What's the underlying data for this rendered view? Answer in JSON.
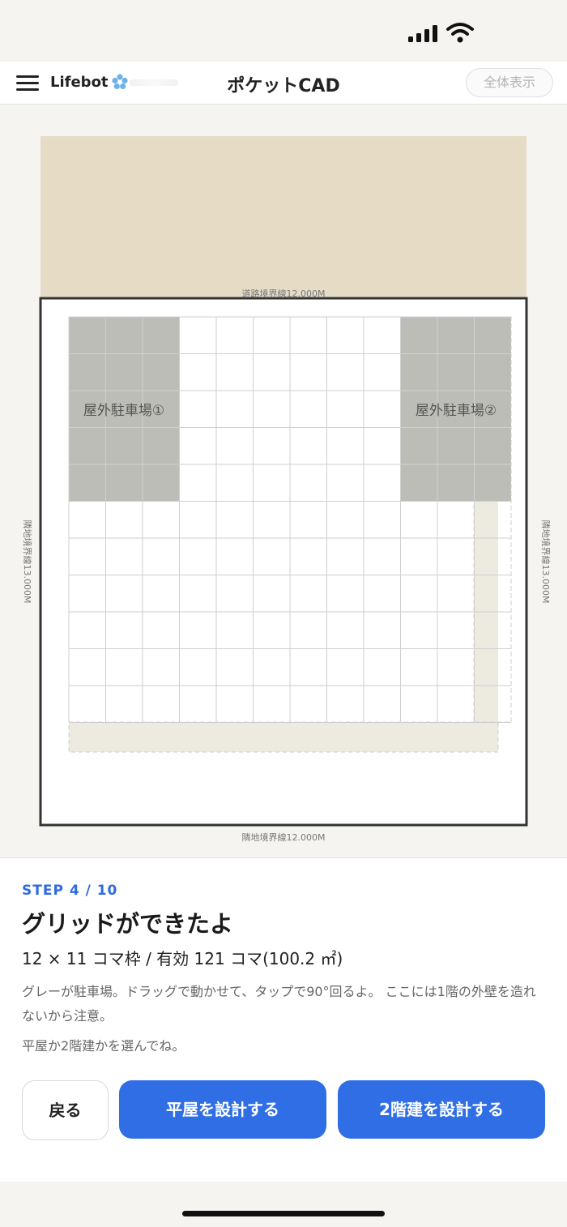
{
  "header": {
    "brand": "Lifebot",
    "title": "ポケットCAD",
    "fit_button": "全体表示"
  },
  "canvas": {
    "road_label": "道路境界線12.000M",
    "left_label": "隣地境界線13.000M",
    "right_label": "隣地境界線13.000M",
    "bottom_label": "隣地境界線12.000M",
    "parking1_label": "屋外駐車場①",
    "parking2_label": "屋外駐車場②",
    "grid_cols": 12,
    "grid_rows": 11,
    "colors": {
      "road": "#e6dcc6",
      "parking": "#bdbdb8",
      "margin": "#edeae0",
      "grid_line": "#cfcfcf",
      "site_border": "#333333"
    }
  },
  "step": {
    "label": "STEP 4 / 10",
    "heading": "グリッドができたよ",
    "summary": "12 × 11 コマ枠 / 有効 121 コマ(100.2 ㎡)",
    "description": "グレーが駐車場。ドラッグで動かせて、タップで90°回るよ。 ここには1階の外壁を造れないから注意。",
    "description2": "平屋か2階建かを選んでね。"
  },
  "buttons": {
    "back": "戻る",
    "flat": "平屋を設計する",
    "two_story": "2階建を設計する"
  }
}
